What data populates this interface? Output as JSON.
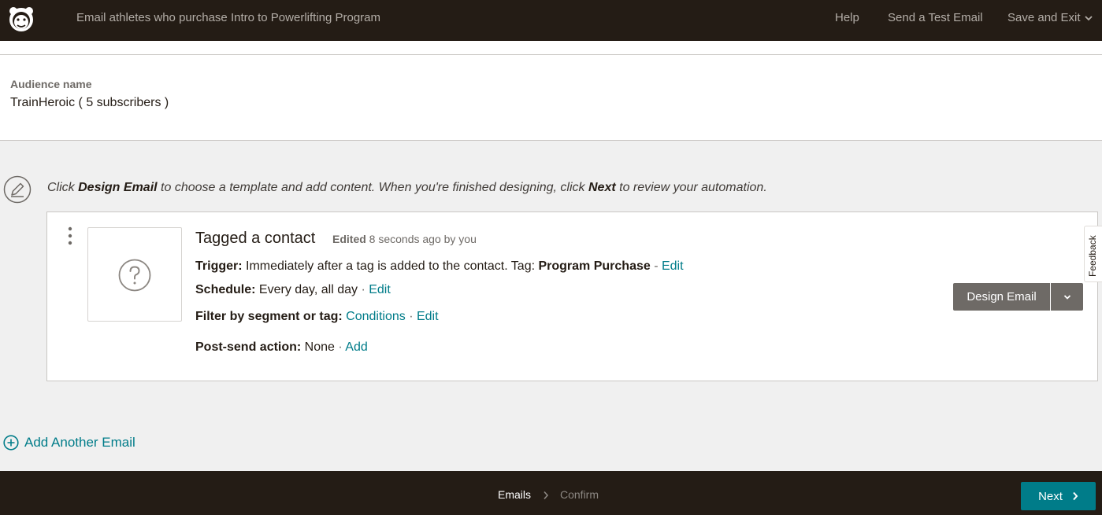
{
  "header": {
    "title": "Email athletes who purchase Intro to Powerlifting Program",
    "help": "Help",
    "send_test": "Send a Test Email",
    "save_exit": "Save and Exit"
  },
  "audience": {
    "label": "Audience name",
    "value": "TrainHeroic ( 5 subscribers )"
  },
  "instruction": {
    "p1": "Click ",
    "b1": "Design Email",
    "p2": " to choose a template and add content. When you're finished designing, click ",
    "b2": "Next",
    "p3": " to review your automation."
  },
  "email": {
    "title": "Tagged a contact",
    "edited_label": "Edited",
    "edited_time": " 8 seconds ago by you",
    "trigger_label": "Trigger:",
    "trigger_text": " Immediately after a tag is added to the contact. Tag: ",
    "trigger_tag": "Program Purchase",
    "trigger_sep": " - ",
    "edit": "Edit",
    "schedule_label": "Schedule:",
    "schedule_text": " Every day, all day",
    "dot_sep": " · ",
    "filter_label": "Filter by segment or tag:",
    "filter_conditions": "Conditions",
    "post_label": "Post-send action:",
    "post_text": " None",
    "add": "Add",
    "design_button": "Design Email"
  },
  "feedback": "Feedback",
  "add_another": "Add Another Email",
  "footer": {
    "step_emails": "Emails",
    "step_confirm": "Confirm",
    "next": "Next"
  },
  "colors": {
    "header_bg": "#241c15",
    "link": "#007c89",
    "button_gray": "#6e6a66",
    "page_bg": "#f0f0f0"
  },
  "icons": {
    "logo": "mailchimp-freddie-logo",
    "save_chevron": "chevron-down-icon",
    "instruction": "pencil-icon",
    "card_menu": "kebab-menu-icon",
    "thumbnail": "question-mark-icon",
    "design_dropdown": "chevron-down-icon",
    "add_email": "plus-circle-icon",
    "step_separator": "chevron-right-icon",
    "next": "chevron-right-icon"
  }
}
